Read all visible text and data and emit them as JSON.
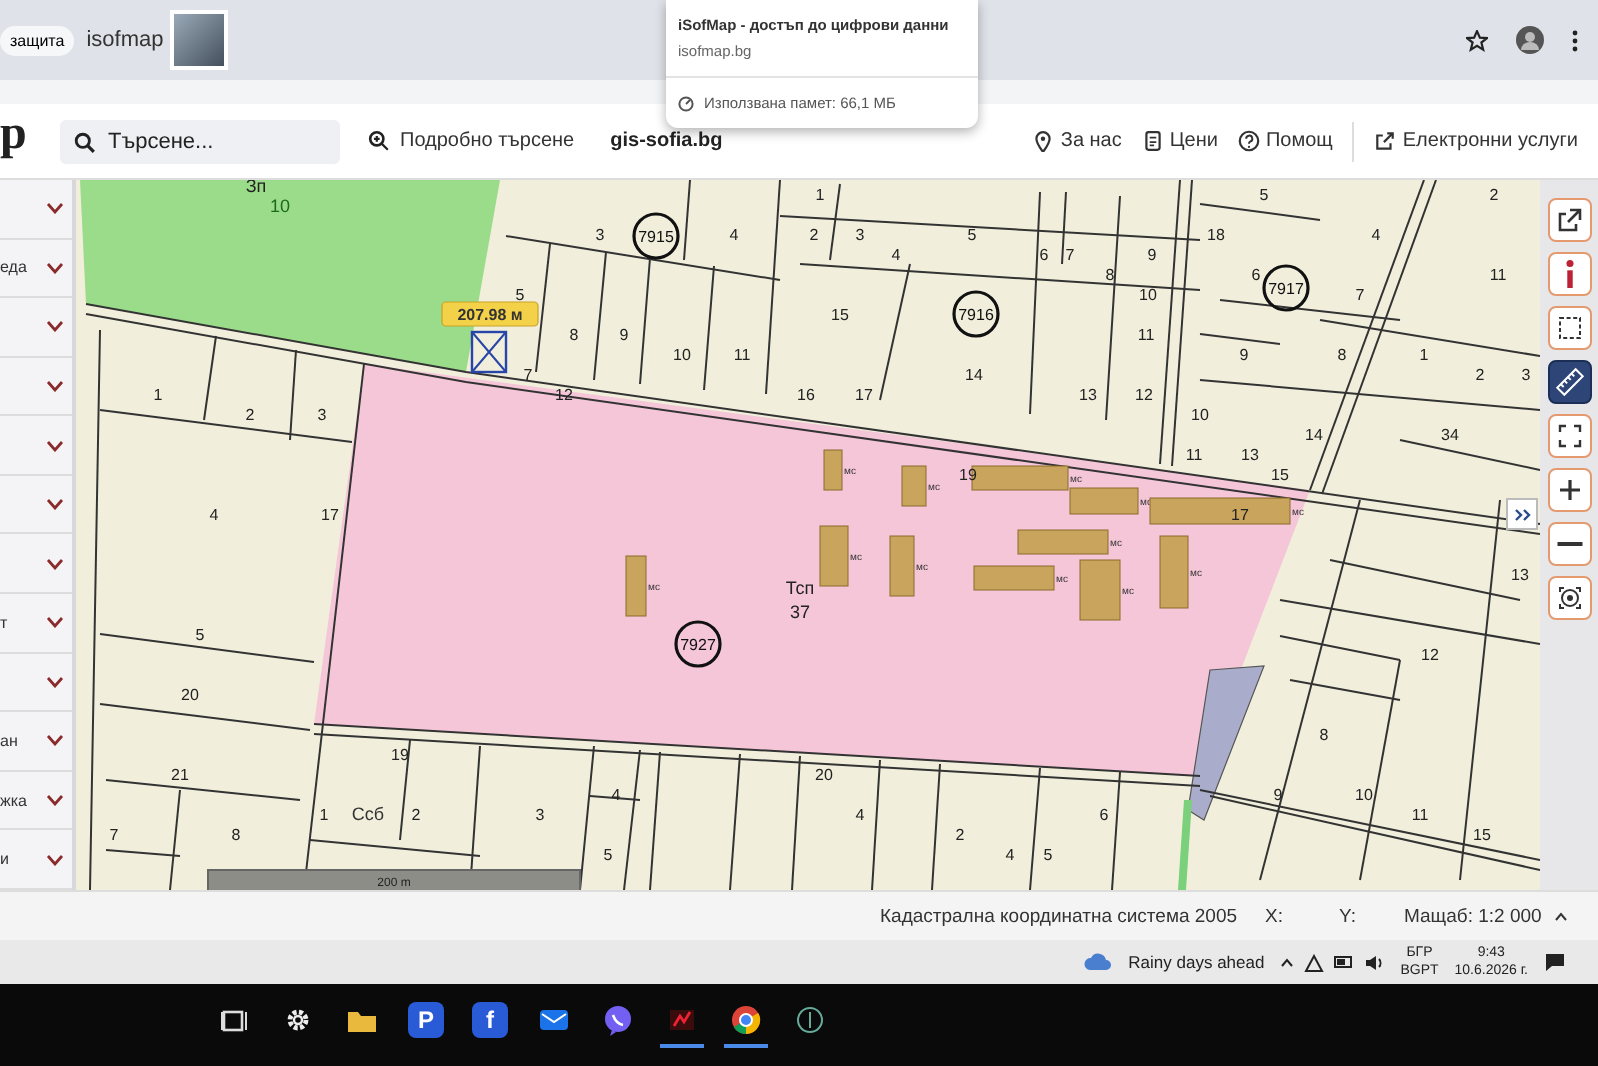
{
  "browser": {
    "security_chip": "защита",
    "tab_title": "isofmap",
    "popup": {
      "title": "iSofMap - достъп до цифрови данни",
      "url": "isofmap.bg",
      "memory": "Използвана памет: 66,1 МБ"
    }
  },
  "toolbar": {
    "logo": "p",
    "search": {
      "placeholder": "Търсене..."
    },
    "advanced_search": "Подробно търсене",
    "site": "gis-sofia.bg",
    "links": [
      {
        "kind": "pin",
        "label": "За нас"
      },
      {
        "kind": "prices",
        "label": "Цени"
      },
      {
        "kind": "help",
        "label": "Помощ"
      },
      {
        "kind": "external",
        "label": "Електронни услуги"
      }
    ]
  },
  "sidebar": {
    "items": [
      {
        "expanded": false
      },
      {
        "label": "еда",
        "expanded": false
      },
      {
        "expanded": false
      },
      {
        "expanded": false
      },
      {
        "expanded": false
      },
      {
        "expanded": false
      },
      {
        "expanded": false
      },
      {
        "label": "т",
        "expanded": false
      },
      {
        "expanded": false
      },
      {
        "label": "ан",
        "expanded": false
      },
      {
        "label": "жка",
        "expanded": false
      },
      {
        "label": "и",
        "expanded": false
      }
    ]
  },
  "map": {
    "zone_labels": [
      "Зп",
      "10",
      "Тсп",
      "37",
      "Ссб"
    ],
    "parcel_numbers": [
      "1",
      "5",
      "2",
      "3",
      "4",
      "2",
      "3",
      "5",
      "18",
      "4",
      "4",
      "6",
      "7",
      "9",
      "8",
      "6",
      "11",
      "5",
      "10",
      "7",
      "15",
      "8",
      "9",
      "11",
      "10",
      "11",
      "9",
      "8",
      "1",
      "7",
      "14",
      "2",
      "3",
      "1",
      "12",
      "16",
      "17",
      "13",
      "12",
      "2",
      "3",
      "10",
      "14",
      "34",
      "11",
      "13",
      "19",
      "15",
      "4",
      "17",
      "17",
      "13",
      "5",
      "12",
      "20",
      "8",
      "19",
      "21",
      "20",
      "4",
      "9",
      "10",
      "1",
      "2",
      "3",
      "4",
      "6",
      "11",
      "7",
      "8",
      "2",
      "15",
      "5",
      "4",
      "5"
    ],
    "property_ids": [
      "7915",
      "7917",
      "7916",
      "7927"
    ],
    "buildings": [
      {
        "label": "мс"
      },
      {
        "label": "мс"
      },
      {
        "label": "мс"
      },
      {
        "label": "мс"
      },
      {
        "label": "мс"
      },
      {
        "label": "мс"
      },
      {
        "label": "мс"
      },
      {
        "label": "мс"
      },
      {
        "label": "мс"
      },
      {
        "label": "мс"
      },
      {
        "label": "мс"
      },
      {
        "label": "мс"
      }
    ],
    "measurement": "207.98 м",
    "scale_bar": "200 m"
  },
  "tools": [
    {
      "kind": "external",
      "selected": false
    },
    {
      "kind": "info",
      "selected": false
    },
    {
      "kind": "select",
      "selected": false
    },
    {
      "kind": "ruler",
      "selected": true
    },
    {
      "kind": "fullscreen",
      "selected": false
    },
    {
      "kind": "zoom-in",
      "selected": false
    },
    {
      "kind": "zoom-out",
      "selected": false
    },
    {
      "kind": "locate",
      "selected": false
    }
  ],
  "status_bar": {
    "coordinate_system": "Кадастрална координатна система 2005",
    "x_label": "X:",
    "y_label": "Y:",
    "scale": "Мащаб: 1:2 000"
  },
  "taskbar": {
    "weather": "Rainy days ahead",
    "language": "БГР",
    "layout": "BGPT",
    "time": "9:43",
    "date": "10.6.2026 г.",
    "apps": [
      {
        "kind": "taskview",
        "running": false
      },
      {
        "kind": "settings",
        "running": false
      },
      {
        "kind": "folder",
        "running": false
      },
      {
        "kind": "letter",
        "glyph": "P",
        "running": false
      },
      {
        "kind": "letter",
        "glyph": "f",
        "running": false
      },
      {
        "kind": "mail",
        "running": false
      },
      {
        "kind": "viber",
        "running": false
      },
      {
        "kind": "red-app",
        "running": true
      },
      {
        "kind": "chrome",
        "running": true
      },
      {
        "kind": "circle-app",
        "running": false
      }
    ]
  }
}
